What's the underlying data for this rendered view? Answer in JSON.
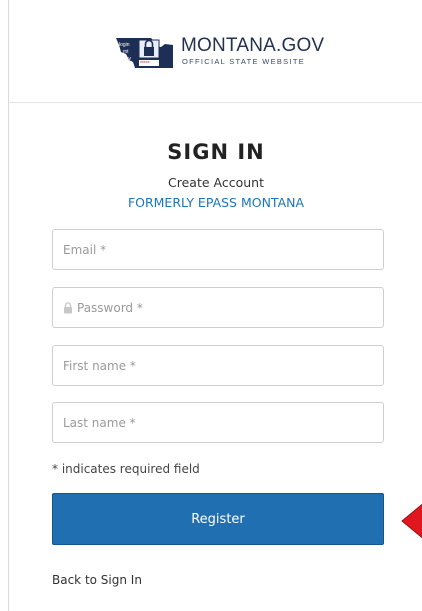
{
  "header": {
    "logo_title": "MONTANA.GOV",
    "logo_subtitle": "OFFICIAL STATE WEBSITE",
    "logo_badge": "login mt.gov"
  },
  "form": {
    "title": "SIGN IN",
    "subtitle": "Create Account",
    "formerly": "FORMERLY EPASS MONTANA",
    "email_placeholder": "Email *",
    "password_placeholder": "Password *",
    "first_name_placeholder": "First name *",
    "last_name_placeholder": "Last name *",
    "required_note": "* indicates required field",
    "register_label": "Register",
    "back_label": "Back to Sign In"
  },
  "colors": {
    "accent": "#1f6fb1",
    "link": "#1b76bc",
    "annotation_arrow": "#e0171f"
  }
}
